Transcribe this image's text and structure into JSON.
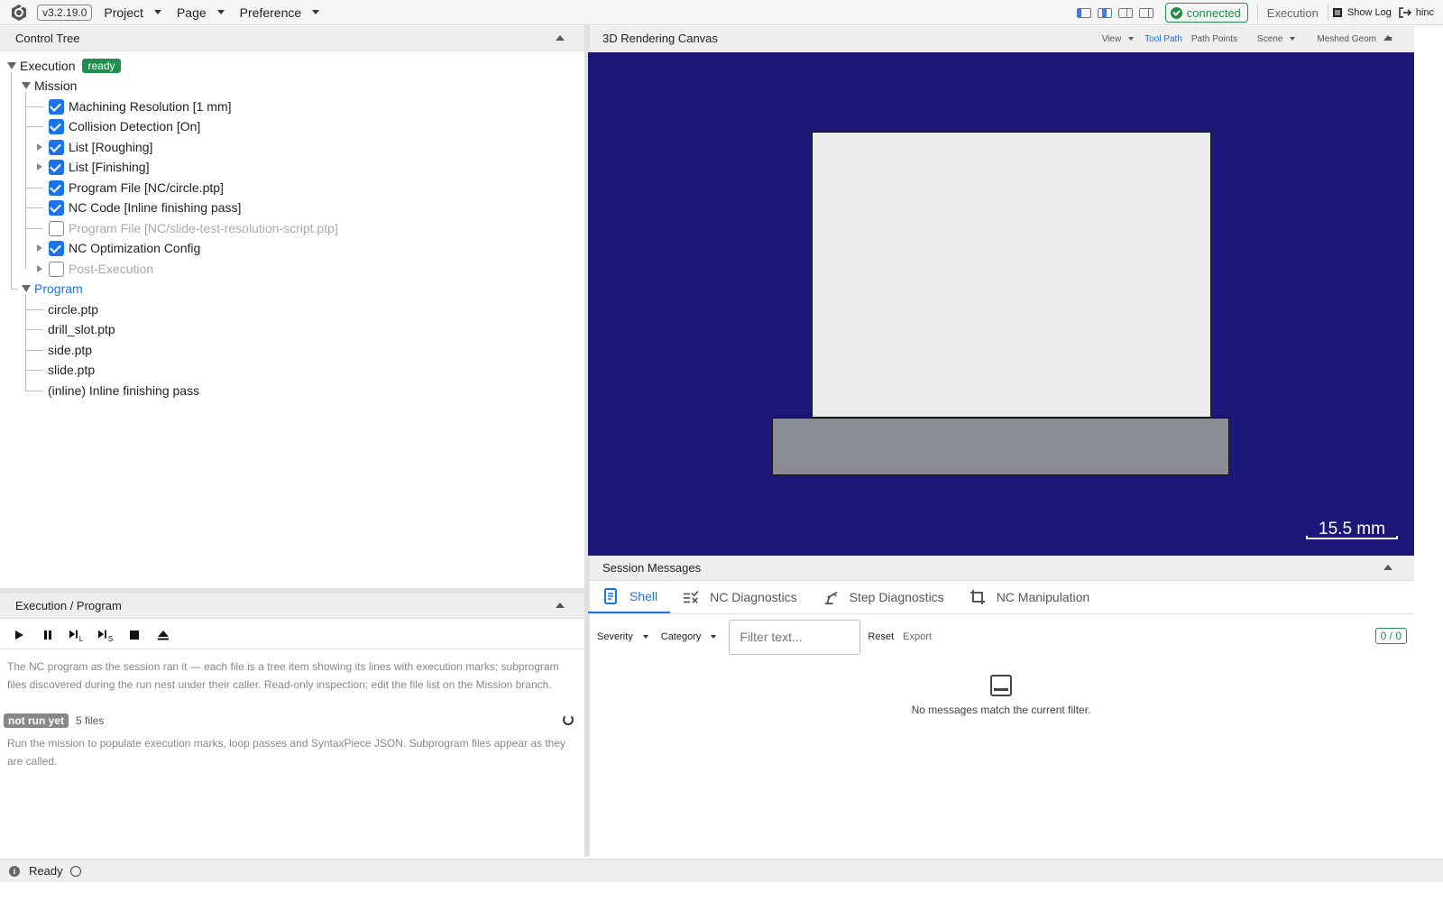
{
  "app": {
    "version": "v3.2.19.0",
    "menus": [
      "Project",
      "Page",
      "Preference"
    ]
  },
  "topright": {
    "status": "connected",
    "page_name": "Execution",
    "show_log": "Show Log",
    "user": "hinc"
  },
  "colors": {
    "accent": "#1a73e8",
    "success": "#1e8f4c",
    "canvas_bg": "#1c187a",
    "part_top": "#ebebeb",
    "part_base": "#898c93"
  },
  "control_tree": {
    "title": "Control Tree",
    "root": {
      "label": "Execution",
      "badge": "ready"
    },
    "mission": {
      "label": "Mission",
      "items": [
        {
          "label": "Machining Resolution [1 mm]",
          "checked": true
        },
        {
          "label": "Collision Detection [On]",
          "checked": true
        },
        {
          "label": "List [Roughing]",
          "checked": true
        },
        {
          "label": "List [Finishing]",
          "checked": true
        },
        {
          "label": "Program File [NC/circle.ptp]",
          "checked": true
        },
        {
          "label": "NC Code [Inline finishing pass]",
          "checked": true
        },
        {
          "label": "Program File [NC/slide-test-resolution-script.ptp]",
          "checked": false
        },
        {
          "label": "NC Optimization Config",
          "checked": true
        },
        {
          "label": "Post-Execution",
          "checked": false
        }
      ]
    },
    "program": {
      "label": "Program",
      "files": [
        "circle.ptp",
        "drill_slot.ptp",
        "side.ptp",
        "slide.ptp",
        "(inline) Inline finishing pass"
      ]
    }
  },
  "exec_panel": {
    "title": "Execution / Program",
    "description": "The NC program as the session ran it — each file is a tree item showing its lines with execution marks; subprogram files discovered during the run nest under their caller. Read-only inspection; edit the file list on the Mission branch.",
    "status_badge": "not run yet",
    "file_count": "5 files",
    "hint": "Run the mission to populate execution marks, loop passes and SyntaxPiece JSON. Subprogram files appear as they are called."
  },
  "canvas": {
    "title": "3D Rendering Canvas",
    "options": {
      "view": "View",
      "tool_path": "Tool Path",
      "path_points": "Path Points",
      "scene": "Scene",
      "meshed_geom": "Meshed Geom"
    },
    "scale_label": "15.5 mm"
  },
  "messages": {
    "title": "Session Messages",
    "tabs": [
      "Shell",
      "NC Diagnostics",
      "Step Diagnostics",
      "NC Manipulation"
    ],
    "filters": {
      "severity": "Severity",
      "category": "Category",
      "placeholder": "Filter text...",
      "reset": "Reset",
      "export": "Export"
    },
    "count": "0 / 0",
    "empty": "No messages match the current filter."
  },
  "statusbar": {
    "text": "Ready"
  }
}
